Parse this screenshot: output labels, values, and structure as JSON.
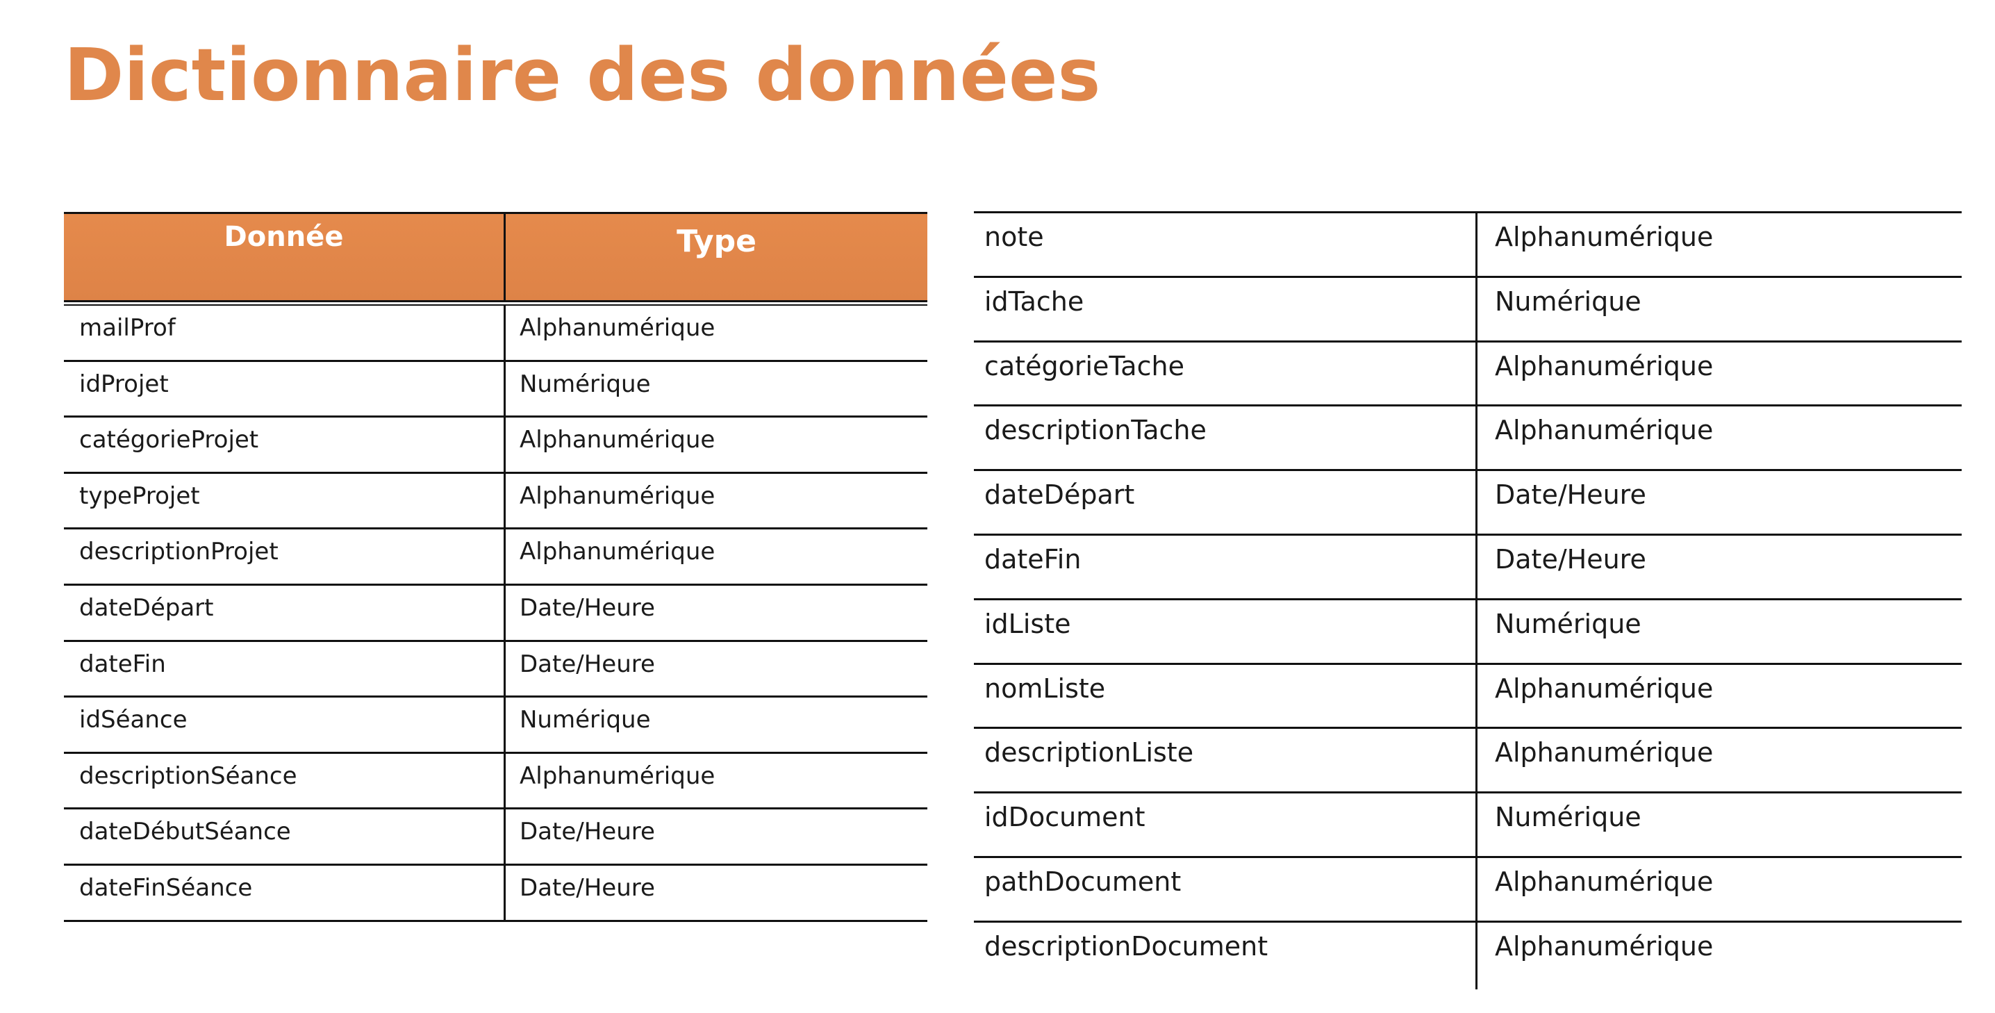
{
  "title": "Dictionnaire des données",
  "left_table": {
    "headers": {
      "donnee": "Donnée",
      "type": "Type"
    },
    "rows": [
      {
        "name": "mailProf",
        "type": "Alphanumérique"
      },
      {
        "name": "idProjet",
        "type": "Numérique"
      },
      {
        "name": "catégorieProjet",
        "type": "Alphanumérique"
      },
      {
        "name": "typeProjet",
        "type": "Alphanumérique"
      },
      {
        "name": "descriptionProjet",
        "type": "Alphanumérique"
      },
      {
        "name": "dateDépart",
        "type": "Date/Heure"
      },
      {
        "name": "dateFin",
        "type": "Date/Heure"
      },
      {
        "name": "idSéance",
        "type": "Numérique"
      },
      {
        "name": "descriptionSéance",
        "type": "Alphanumérique"
      },
      {
        "name": "dateDébutSéance",
        "type": "Date/Heure"
      },
      {
        "name": "dateFinSéance",
        "type": "Date/Heure"
      }
    ]
  },
  "right_table": {
    "rows": [
      {
        "name": "note",
        "type": "Alphanumérique"
      },
      {
        "name": "idTache",
        "type": "Numérique"
      },
      {
        "name": "catégorieTache",
        "type": "Alphanumérique"
      },
      {
        "name": "descriptionTache",
        "type": "Alphanumérique"
      },
      {
        "name": "dateDépart",
        "type": "Date/Heure"
      },
      {
        "name": "dateFin",
        "type": "Date/Heure"
      },
      {
        "name": "idListe",
        "type": "Numérique"
      },
      {
        "name": "nomListe",
        "type": "Alphanumérique"
      },
      {
        "name": "descriptionListe",
        "type": "Alphanumérique"
      },
      {
        "name": "idDocument",
        "type": "Numérique"
      },
      {
        "name": "pathDocument",
        "type": "Alphanumérique"
      },
      {
        "name": "descriptionDocument",
        "type": "Alphanumérique"
      }
    ]
  },
  "colors": {
    "accent": "#e0874b",
    "header_bg": "#e58a4c",
    "rule": "#111111"
  }
}
